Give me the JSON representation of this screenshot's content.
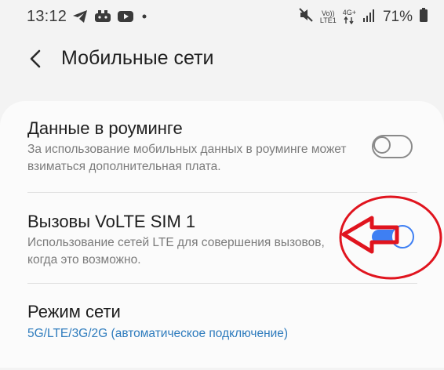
{
  "status_bar": {
    "time": "13:12",
    "left_icons": [
      "telegram-icon",
      "game-controller-icon",
      "youtube-icon",
      "dot-icon"
    ],
    "right_icons": [
      "mute-icon",
      "volte-icon",
      "4g-data-icon",
      "signal-icon",
      "battery-icon"
    ],
    "volte_top": "Vo))",
    "volte_bottom": "LTE1",
    "network_type": "4G+",
    "battery_percent": "71%"
  },
  "header": {
    "title": "Мобильные сети",
    "back_icon": "back-arrow-icon"
  },
  "settings": {
    "roaming": {
      "title": "Данные в роуминге",
      "description": "За использование мобильных данных в роуминге может взиматься дополнительная плата.",
      "enabled": false
    },
    "volte": {
      "title": "Вызовы VoLTE SIM 1",
      "description": "Использование сетей LTE для совершения вызовов, когда это возможно.",
      "enabled": true
    },
    "network_mode": {
      "title": "Режим сети",
      "value": "5G/LTE/3G/2G (автоматическое подключение)"
    }
  },
  "colors": {
    "accent": "#3e7ff3",
    "link": "#2d7bbd",
    "annotation": "#e0141e"
  }
}
